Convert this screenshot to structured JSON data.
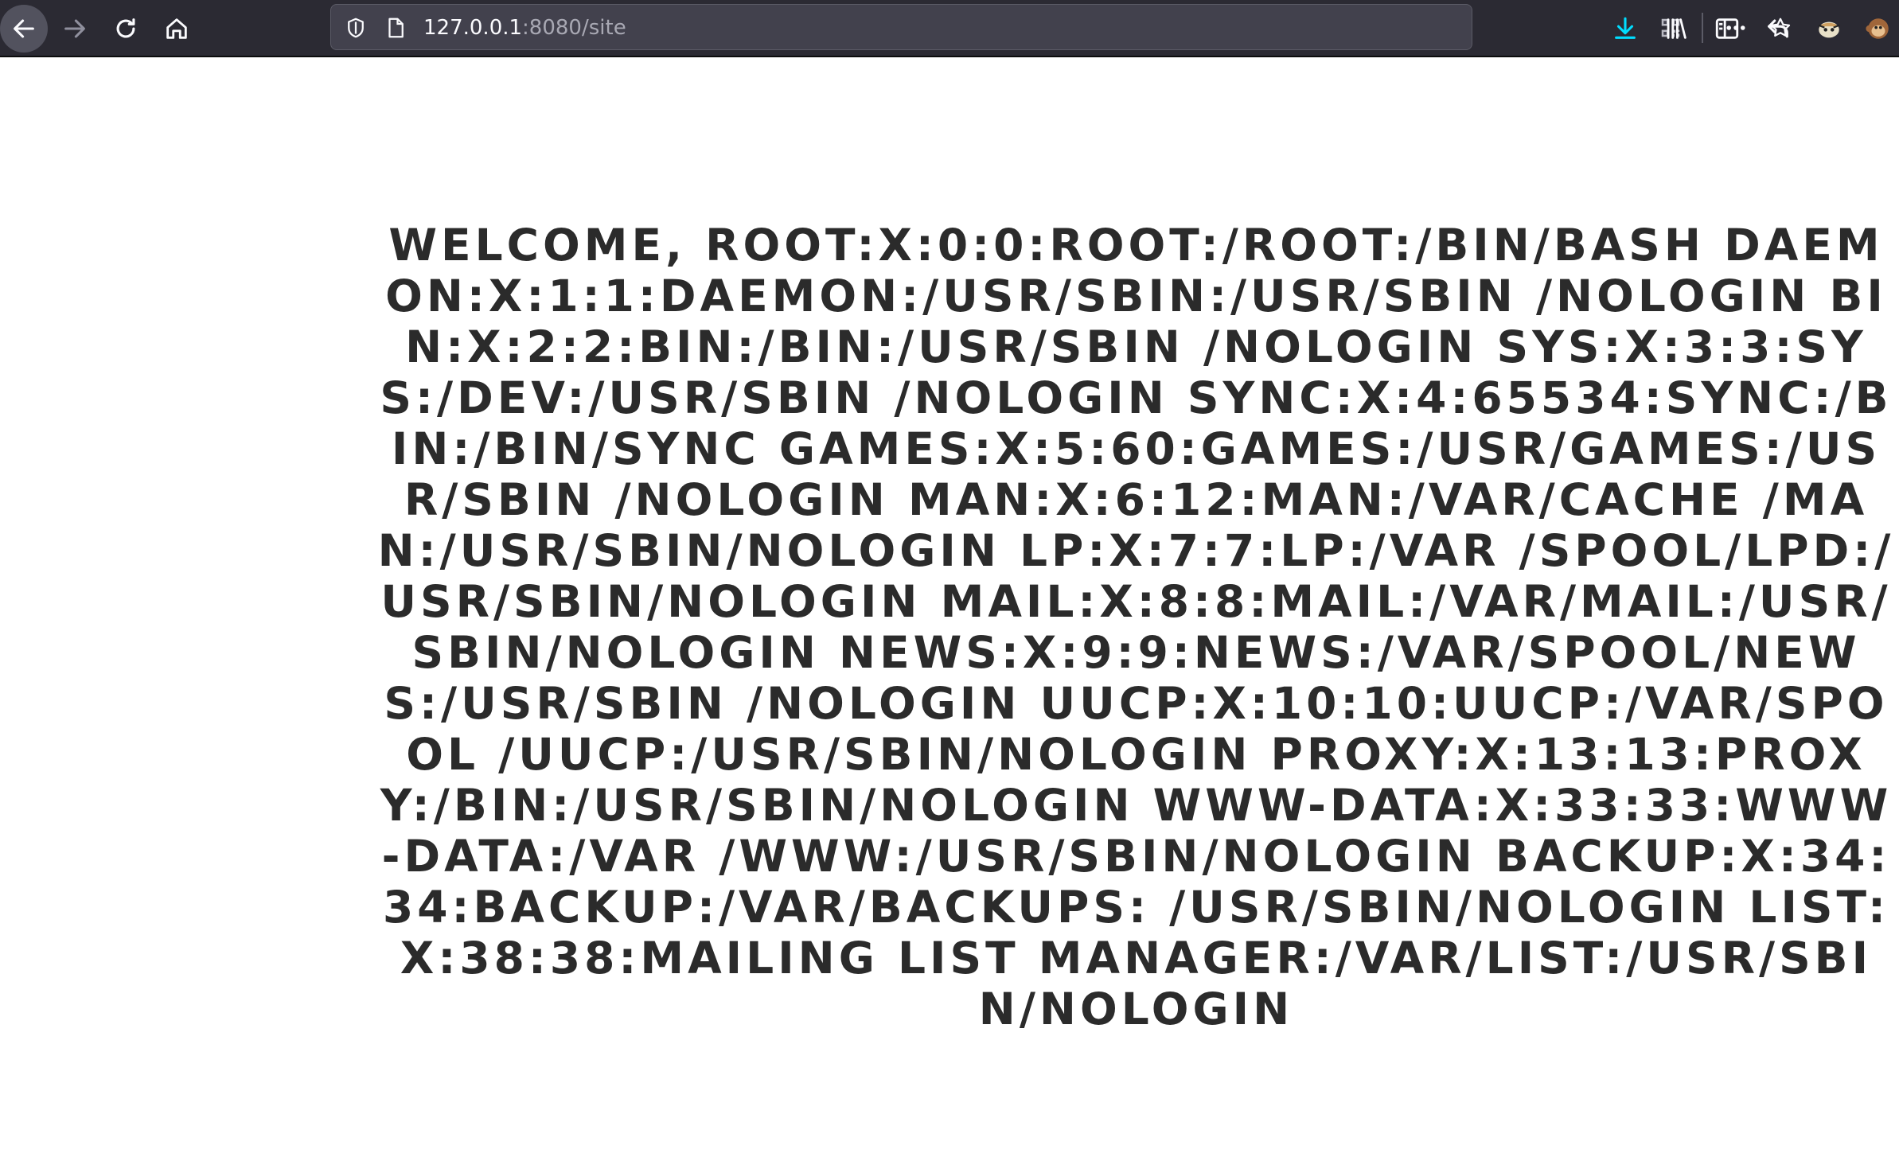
{
  "browser": {
    "url_host": "127.0.0.1",
    "url_rest": ":8080/site",
    "icons": {
      "back": "arrow-left-icon",
      "forward": "arrow-right-icon",
      "reload": "reload-icon",
      "home": "home-icon",
      "tracking_protection": "shield-icon",
      "page_info": "page-icon",
      "qr_code": "qr-code-icon",
      "page_actions": "more-icon",
      "bookmark": "star-icon",
      "downloads": "download-icon",
      "library": "library-icon",
      "sidebar": "sidebar-icon",
      "undo_close": "undo-icon",
      "extension_1": "extension-icon",
      "extension_2": "monkey-icon"
    },
    "colors": {
      "toolbar_bg": "#2b2a33",
      "urlbar_bg": "#42414d",
      "download_accent": "#00ddff",
      "text": "#fbfbfe"
    }
  },
  "page": {
    "welcome_text": "Welcome, root:x:0:0:root:/root:/bin/bash daemon:x:1:1:daemon:/usr/sbin:/usr/sbin /nologin bin:x:2:2:bin:/bin:/usr/sbin /nologin sys:x:3:3:sys:/dev:/usr/sbin /nologin sync:x:4:65534:sync:/bin:/bin/sync games:x:5:60:games:/usr/games:/usr/sbin /nologin man:x:6:12:man:/var/cache /man:/usr/sbin/nologin lp:x:7:7:lp:/var /spool/lpd:/usr/sbin/nologin mail:x:8:8:mail:/var/mail:/usr/sbin/nologin news:x:9:9:news:/var/spool/news:/usr/sbin /nologin uucp:x:10:10:uucp:/var/spool /uucp:/usr/sbin/nologin proxy:x:13:13:proxy:/bin:/usr/sbin/nologin www-data:x:33:33:www-data:/var /www:/usr/sbin/nologin backup:x:34:34:backup:/var/backups: /usr/sbin/nologin list:x:38:38:mailing list manager:/var/list:/usr/sbin/nologin",
    "text_color": "#2b2b2b"
  }
}
